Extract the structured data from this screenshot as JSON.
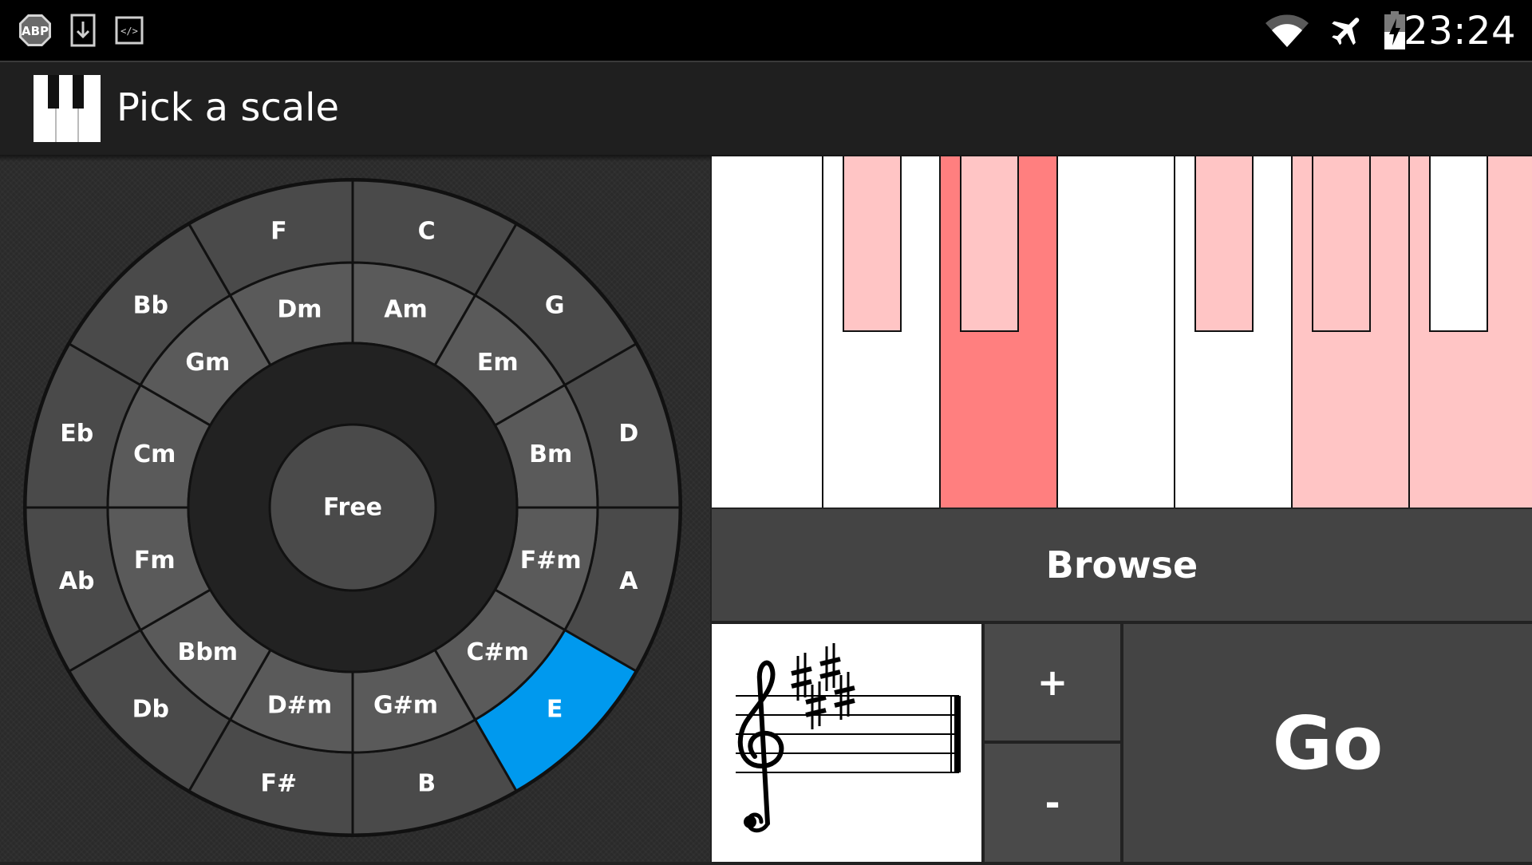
{
  "status_bar": {
    "time": "23:24",
    "left_icons": [
      "adblock-icon",
      "download-icon",
      "code-icon"
    ],
    "right_icons": [
      "wifi-icon",
      "airplane-mode-icon",
      "battery-charging-icon"
    ],
    "abp_text": "ABP",
    "code_text": "</>"
  },
  "app_bar": {
    "icon": "piano-keys-icon",
    "title": "Pick a scale"
  },
  "circle_of_fifths": {
    "center_label": "Free",
    "selected": "E",
    "selected_color": "#0099ee",
    "segment_color": "#4a4a4a",
    "inner_ring_color": "#5a5a5a",
    "outer_ring": [
      "C",
      "G",
      "D",
      "A",
      "E",
      "B",
      "F#",
      "Db",
      "Ab",
      "Eb",
      "Bb",
      "F"
    ],
    "middle_ring": [
      "Am",
      "Em",
      "Bm",
      "F#m",
      "C#m",
      "G#m",
      "D#m",
      "Bbm",
      "Fm",
      "Cm",
      "Gm",
      "Dm"
    ]
  },
  "piano": {
    "highlight_light": "#ffc5c5",
    "highlight_strong": "#ff7f7f",
    "white_keys": [
      "",
      "",
      "strong",
      "",
      "",
      "light",
      "light"
    ],
    "black_keys": [
      "light",
      "light",
      "light",
      "light",
      ""
    ],
    "black_key_positions": [
      1.5,
      2.5,
      4.5,
      5.5,
      6.5
    ]
  },
  "controls": {
    "browse_label": "Browse",
    "plus_label": "+",
    "minus_label": "-",
    "go_label": "Go"
  },
  "key_signature": {
    "clef": "treble-clef-icon",
    "accidental": "sharp",
    "count": 4
  }
}
